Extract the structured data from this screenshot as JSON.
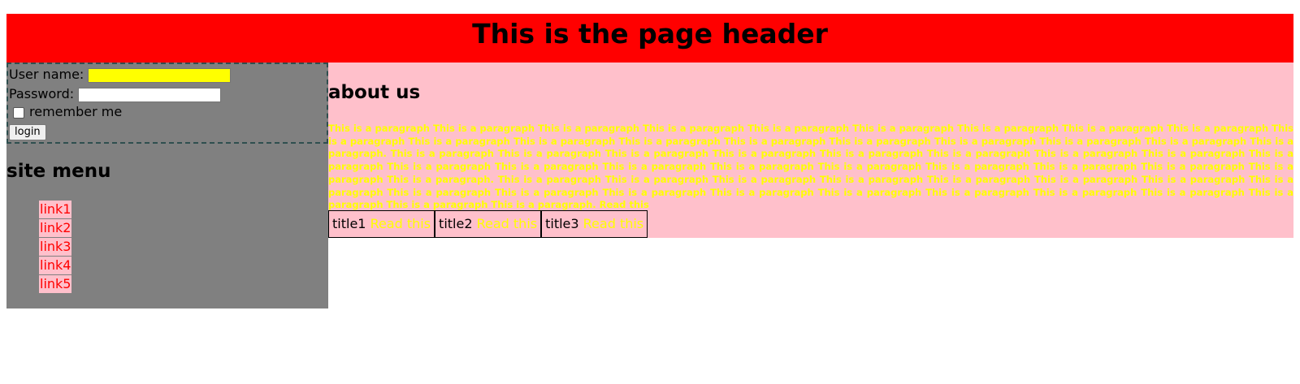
{
  "header": {
    "title": "This is the page header"
  },
  "login": {
    "username_label": "User name:",
    "username_value": "",
    "password_label": "Password:",
    "password_value": "",
    "remember_label": "remember me",
    "remember_checked": false,
    "button_label": "login"
  },
  "site_menu": {
    "title": "site menu",
    "links": [
      "link1",
      "link2",
      "link3",
      "link4",
      "link5"
    ]
  },
  "main": {
    "title": "about us",
    "paragraph": "This is a paragraph This is a paragraph This is a paragraph This is a paragraph This is a paragraph This is a paragraph This is a paragraph This is a paragraph This is a paragraph This is a paragraph This is a paragraph This is a paragraph This is a paragraph This is a paragraph This is a paragraph This is a paragraph This is a paragraph This is a paragraph This is a paragraph. This is a paragraph This is a paragraph This is a paragraph This is a paragraph This is a paragraph This is a paragraph This is a paragraph This is a paragraph This is a paragraph This is a paragraph This is a paragraph This is a paragraph This is a paragraph This is a paragraph This is a paragraph This is a paragraph This is a paragraph This is a paragraph This is a paragraph. This is a paragraph This is a paragraph This is a paragraph This is a paragraph This is a paragraph This is a paragraph This is a paragraph This is a paragraph This is a paragraph This is a paragraph This is a paragraph This is a paragraph This is a paragraph This is a paragraph This is a paragraph This is a paragraph This is a paragraph This is a paragraph This is a paragraph.",
    "paragraph_link": "Read this",
    "boxes": [
      {
        "title": "title1",
        "link": "Read this"
      },
      {
        "title": "title2",
        "link": "Read this"
      },
      {
        "title": "title3",
        "link": "Read this"
      }
    ]
  },
  "colors": {
    "header_bg": "#ff0000",
    "sidebar_bg": "#808080",
    "main_bg": "#ffc0cb",
    "link_color": "#ff0000",
    "paragraph_color": "#ffff00",
    "username_bg": "#ffff00"
  }
}
